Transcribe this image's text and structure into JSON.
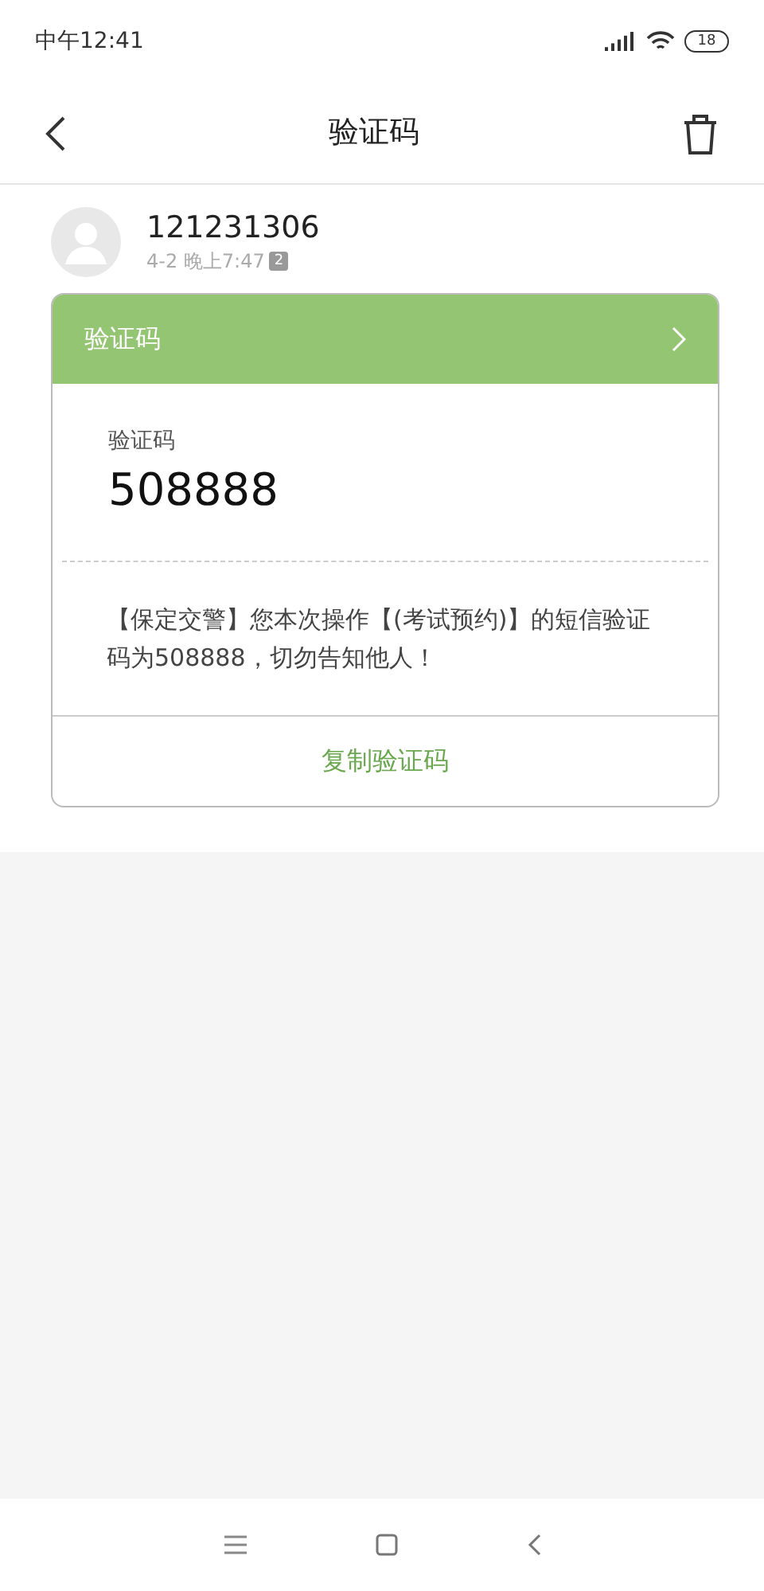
{
  "status_bar": {
    "time": "中午12:41",
    "battery": "18"
  },
  "header": {
    "title": "验证码"
  },
  "message": {
    "sender": "121231306",
    "time": "4-2 晚上7:47",
    "sim": "2"
  },
  "card": {
    "header_title": "验证码",
    "code_label": "验证码",
    "code": "508888",
    "text": "【保定交警】您本次操作【(考试预约)】的短信验证码为508888，切勿告知他人！",
    "action": "复制验证码"
  }
}
